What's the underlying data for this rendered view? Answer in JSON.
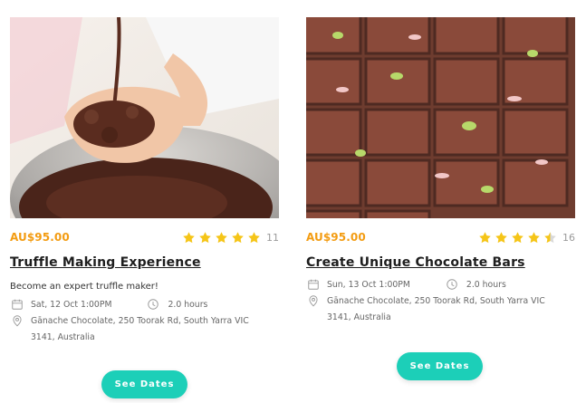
{
  "cards": [
    {
      "price": "AU$95.00",
      "rating": 5,
      "review_count": "11",
      "title": "Truffle Making Experience",
      "subtitle": "Become an expert truffle maker!",
      "date": "Sat, 12 Oct 1:00PM",
      "duration": "2.0 hours",
      "address": "Gānache Chocolate, 250 Toorak Rd, South Yarra VIC 3141, Australia",
      "button_label": "See Dates"
    },
    {
      "price": "AU$95.00",
      "rating": 4.5,
      "review_count": "16",
      "title": "Create Unique Chocolate Bars",
      "subtitle": "",
      "date": "Sun, 13 Oct 1:00PM",
      "duration": "2.0 hours",
      "address": "Gānache Chocolate, 250 Toorak Rd, South Yarra VIC 3141, Australia",
      "button_label": "See Dates"
    }
  ],
  "colors": {
    "price": "#f39c12",
    "star": "#f5c518",
    "button": "#1ccfb8"
  }
}
